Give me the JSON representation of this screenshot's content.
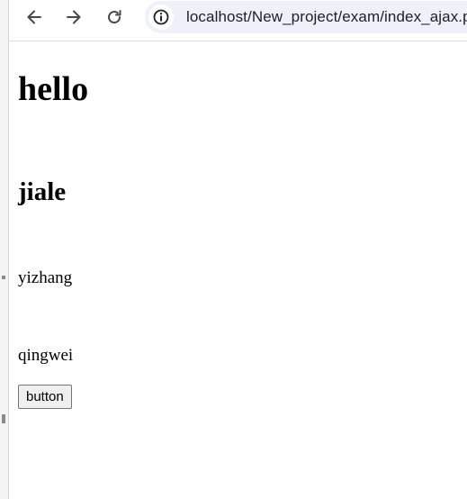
{
  "browser": {
    "url": "localhost/New_project/exam/index_ajax.php",
    "icons": {
      "back": "arrow-back-icon",
      "forward": "arrow-forward-icon",
      "reload": "reload-icon",
      "site_info": "info-circle-icon"
    }
  },
  "page": {
    "heading": "hello",
    "subheading": "jiale",
    "lines": [
      "yizhang",
      "qingwei"
    ],
    "button_label": "button"
  }
}
